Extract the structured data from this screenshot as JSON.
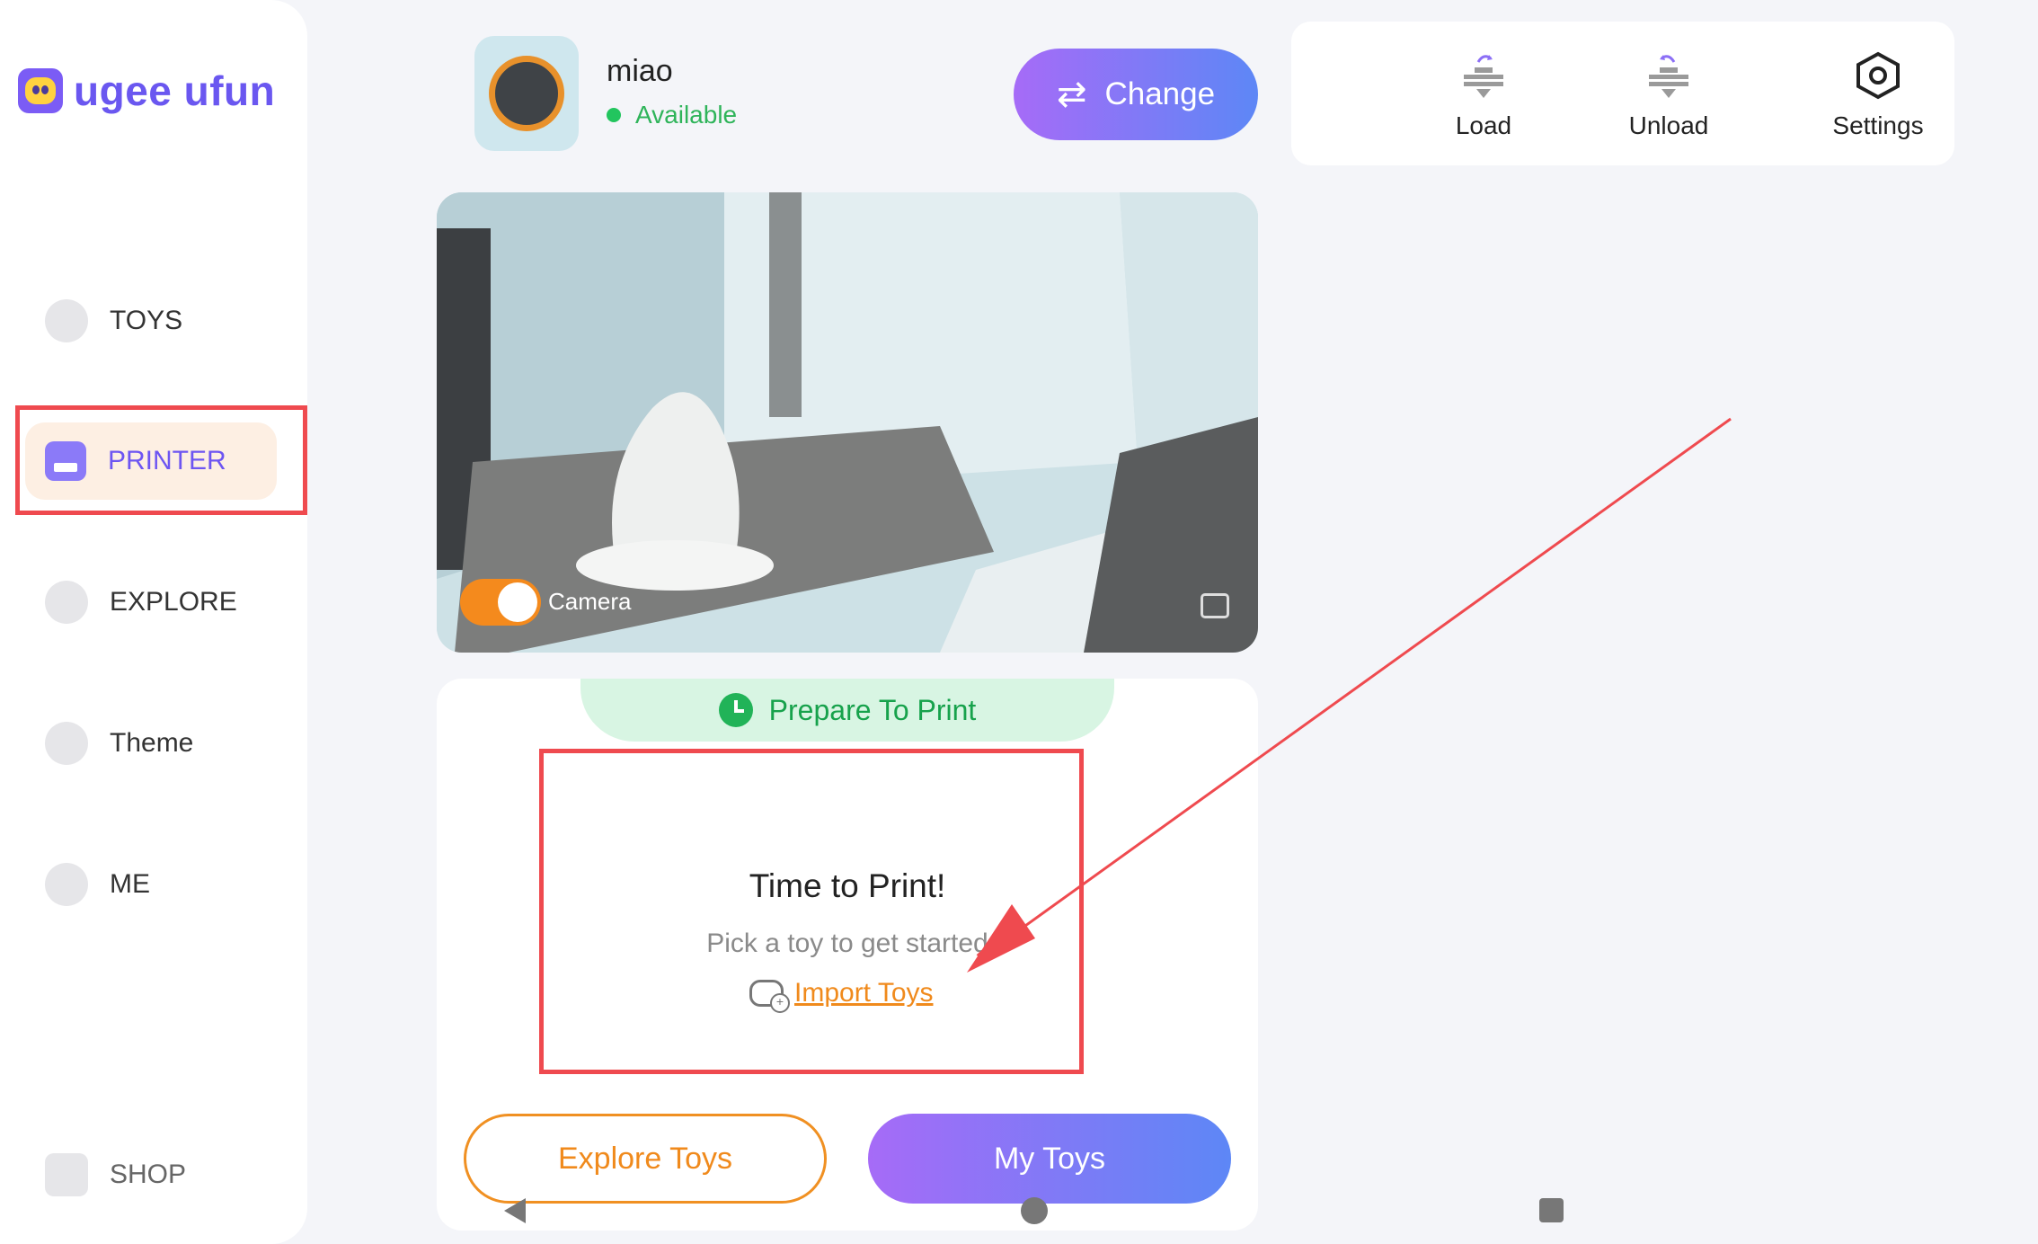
{
  "app": {
    "logo_text": "ugee ufun"
  },
  "sidebar": {
    "items": [
      {
        "label": "TOYS",
        "icon": "teddy-bear-icon"
      },
      {
        "label": "PRINTER",
        "icon": "printer-icon",
        "active": true
      },
      {
        "label": "EXPLORE",
        "icon": "planet-icon"
      },
      {
        "label": "Theme",
        "icon": "star-icon"
      },
      {
        "label": "ME",
        "icon": "smiley-face-icon"
      },
      {
        "label": "SHOP",
        "icon": "shopping-bag-icon"
      }
    ]
  },
  "printer": {
    "name": "miao",
    "status": "Available",
    "change_label": "Change"
  },
  "tools": {
    "load_label": "Load",
    "unload_label": "Unload",
    "settings_label": "Settings"
  },
  "camera": {
    "label": "Camera",
    "toggle_on": true
  },
  "print_card": {
    "status_label": "Prepare To Print",
    "title": "Time to Print!",
    "subtitle": "Pick a toy to get started",
    "import_label": "Import Toys",
    "explore_label": "Explore Toys",
    "mytoys_label": "My Toys"
  },
  "colors": {
    "accent_purple": "#6d55f2",
    "accent_orange": "#f08a1c",
    "status_green": "#22c55e",
    "annotation_red": "#ef4a4f"
  }
}
